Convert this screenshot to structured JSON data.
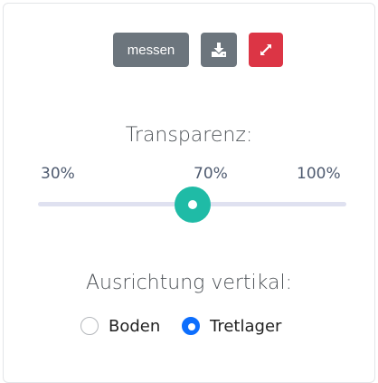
{
  "toolbar": {
    "measure_label": "messen",
    "download_icon": "download-icon",
    "expand_icon": "expand-icon",
    "colors": {
      "secondary": "#6c757d",
      "danger": "#dc3545"
    }
  },
  "transparency": {
    "label": "Transparenz:",
    "ticks": [
      "30%",
      "70%",
      "100%"
    ],
    "value_percent": 70,
    "min_percent": 30,
    "max_percent": 100,
    "accent_color": "#1fbba6"
  },
  "orientation": {
    "label": "Ausrichtung vertikal:",
    "options": [
      {
        "label": "Boden",
        "checked": false
      },
      {
        "label": "Tretlager",
        "checked": true
      }
    ],
    "accent_color": "#0d6efd"
  }
}
